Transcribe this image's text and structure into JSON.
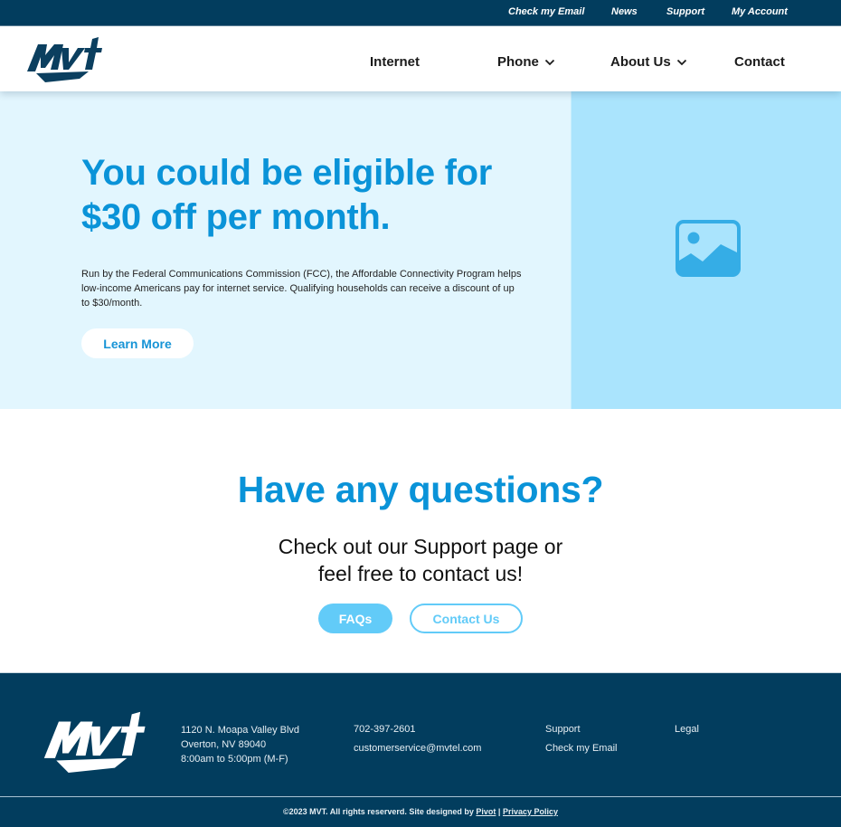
{
  "utility_nav": {
    "items": [
      {
        "label": "Check my Email"
      },
      {
        "label": "News"
      },
      {
        "label": "Support"
      },
      {
        "label": "My Account"
      }
    ]
  },
  "header": {
    "logo_alt": "MVT",
    "nav": [
      {
        "label": "Internet",
        "has_dropdown": false
      },
      {
        "label": "Phone",
        "has_dropdown": true
      },
      {
        "label": "About Us",
        "has_dropdown": true
      },
      {
        "label": "Contact",
        "has_dropdown": false
      }
    ]
  },
  "hero": {
    "title": "You could be eligible for $30 off per month.",
    "body": "Run by the Federal Communications Commission (FCC), the Affordable Connectivity Program helps low-income Americans pay for internet service. Qualifying households can receive a discount of up to $30/month.",
    "cta_label": "Learn More",
    "image_icon": "image-placeholder-icon"
  },
  "questions": {
    "title": "Have any questions?",
    "subtitle_line1": "Check out our Support page or",
    "subtitle_line2": "feel free to contact us!",
    "faq_label": "FAQs",
    "contact_label": "Contact Us"
  },
  "footer": {
    "address_line1": "1120 N. Moapa Valley Blvd",
    "address_line2": "Overton, NV 89040",
    "hours": "8:00am to 5:00pm (M-F)",
    "phone": "702-397-2601",
    "email": "customerservice@mvtel.com",
    "links": [
      {
        "label": "Support"
      },
      {
        "label": "Check my Email"
      }
    ],
    "legal_label": "Legal",
    "copyright": "©2023 MVT. All rights reserverd. Site designed by",
    "designer_link": "Pivot",
    "separator": "|",
    "privacy_link": "Privacy Policy"
  },
  "colors": {
    "navy": "#023d5e",
    "brand_blue": "#0a93d8",
    "light_blue_bg": "#e2f6fe",
    "image_bg": "#aae4fd",
    "button_blue": "#62cbf8"
  }
}
